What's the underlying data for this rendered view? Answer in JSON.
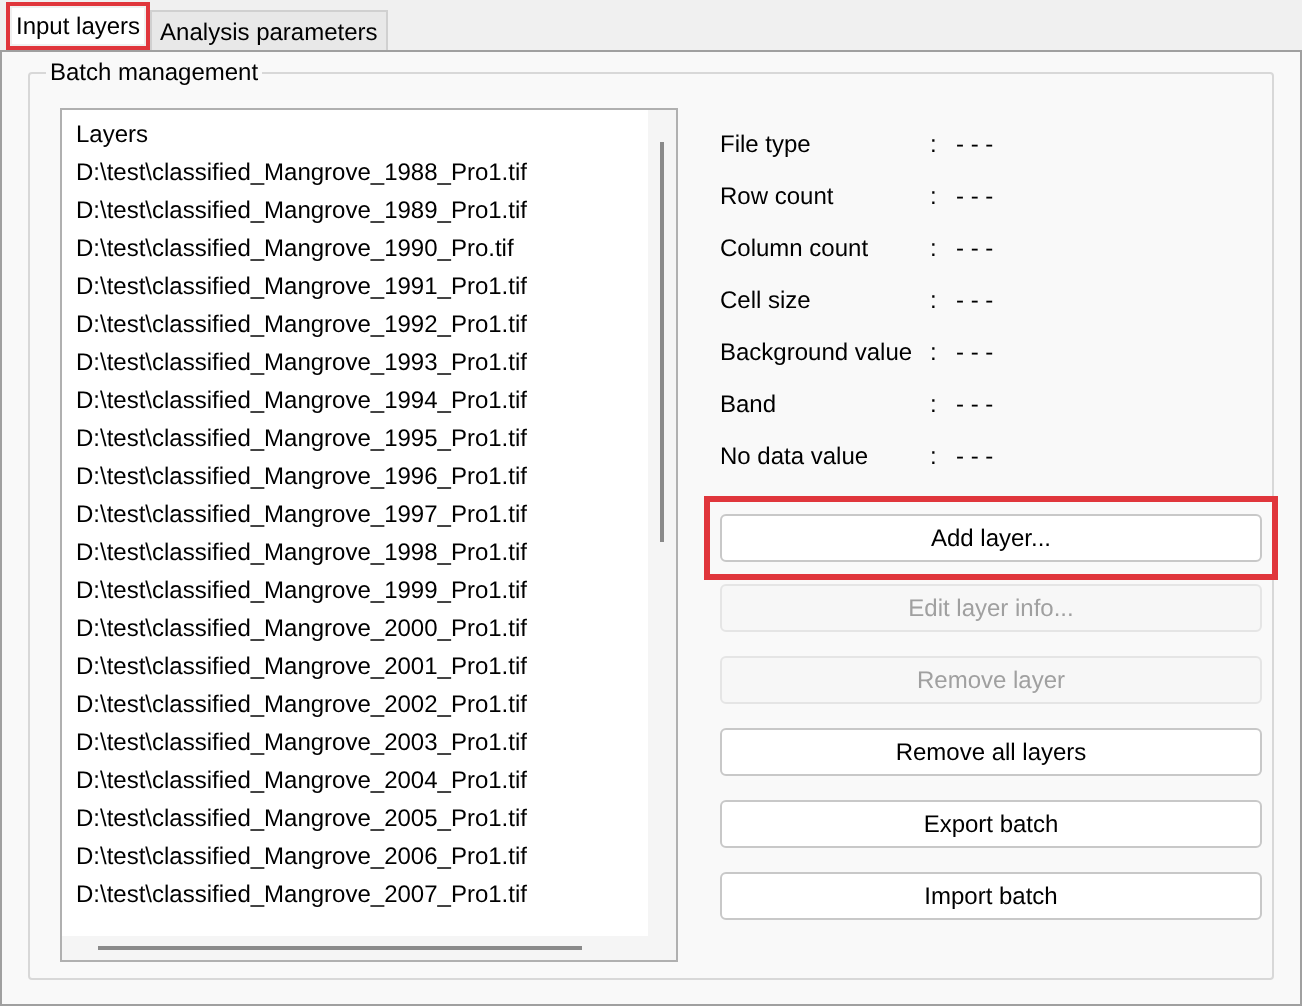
{
  "tabs": [
    {
      "label": "Input layers",
      "selected": true,
      "highlighted": true
    },
    {
      "label": "Analysis parameters",
      "selected": false,
      "highlighted": false
    }
  ],
  "group": {
    "title": "Batch management"
  },
  "layers": {
    "header": "Layers",
    "items": [
      "D:\\test\\classified_Mangrove_1988_Pro1.tif",
      "D:\\test\\classified_Mangrove_1989_Pro1.tif",
      "D:\\test\\classified_Mangrove_1990_Pro.tif",
      "D:\\test\\classified_Mangrove_1991_Pro1.tif",
      "D:\\test\\classified_Mangrove_1992_Pro1.tif",
      "D:\\test\\classified_Mangrove_1993_Pro1.tif",
      "D:\\test\\classified_Mangrove_1994_Pro1.tif",
      "D:\\test\\classified_Mangrove_1995_Pro1.tif",
      "D:\\test\\classified_Mangrove_1996_Pro1.tif",
      "D:\\test\\classified_Mangrove_1997_Pro1.tif",
      "D:\\test\\classified_Mangrove_1998_Pro1.tif",
      "D:\\test\\classified_Mangrove_1999_Pro1.tif",
      "D:\\test\\classified_Mangrove_2000_Pro1.tif",
      "D:\\test\\classified_Mangrove_2001_Pro1.tif",
      "D:\\test\\classified_Mangrove_2002_Pro1.tif",
      "D:\\test\\classified_Mangrove_2003_Pro1.tif",
      "D:\\test\\classified_Mangrove_2004_Pro1.tif",
      "D:\\test\\classified_Mangrove_2005_Pro1.tif",
      "D:\\test\\classified_Mangrove_2006_Pro1.tif",
      "D:\\test\\classified_Mangrove_2007_Pro1.tif"
    ]
  },
  "info": [
    {
      "label": "File type",
      "value": "- - -"
    },
    {
      "label": "Row count",
      "value": "- - -"
    },
    {
      "label": "Column count",
      "value": "- - -"
    },
    {
      "label": "Cell size",
      "value": "- - -"
    },
    {
      "label": "Background value",
      "value": "- - -"
    },
    {
      "label": "Band",
      "value": "- - -"
    },
    {
      "label": "No data value",
      "value": "- - -"
    }
  ],
  "separator": ":",
  "buttons": [
    {
      "label": "Add layer...",
      "disabled": false,
      "highlighted": true
    },
    {
      "label": "Edit layer info...",
      "disabled": true,
      "highlighted": false
    },
    {
      "label": "Remove layer",
      "disabled": true,
      "highlighted": false
    },
    {
      "label": "Remove all layers",
      "disabled": false,
      "highlighted": false
    },
    {
      "label": "Export batch",
      "disabled": false,
      "highlighted": false
    },
    {
      "label": "Import batch",
      "disabled": false,
      "highlighted": false
    }
  ]
}
